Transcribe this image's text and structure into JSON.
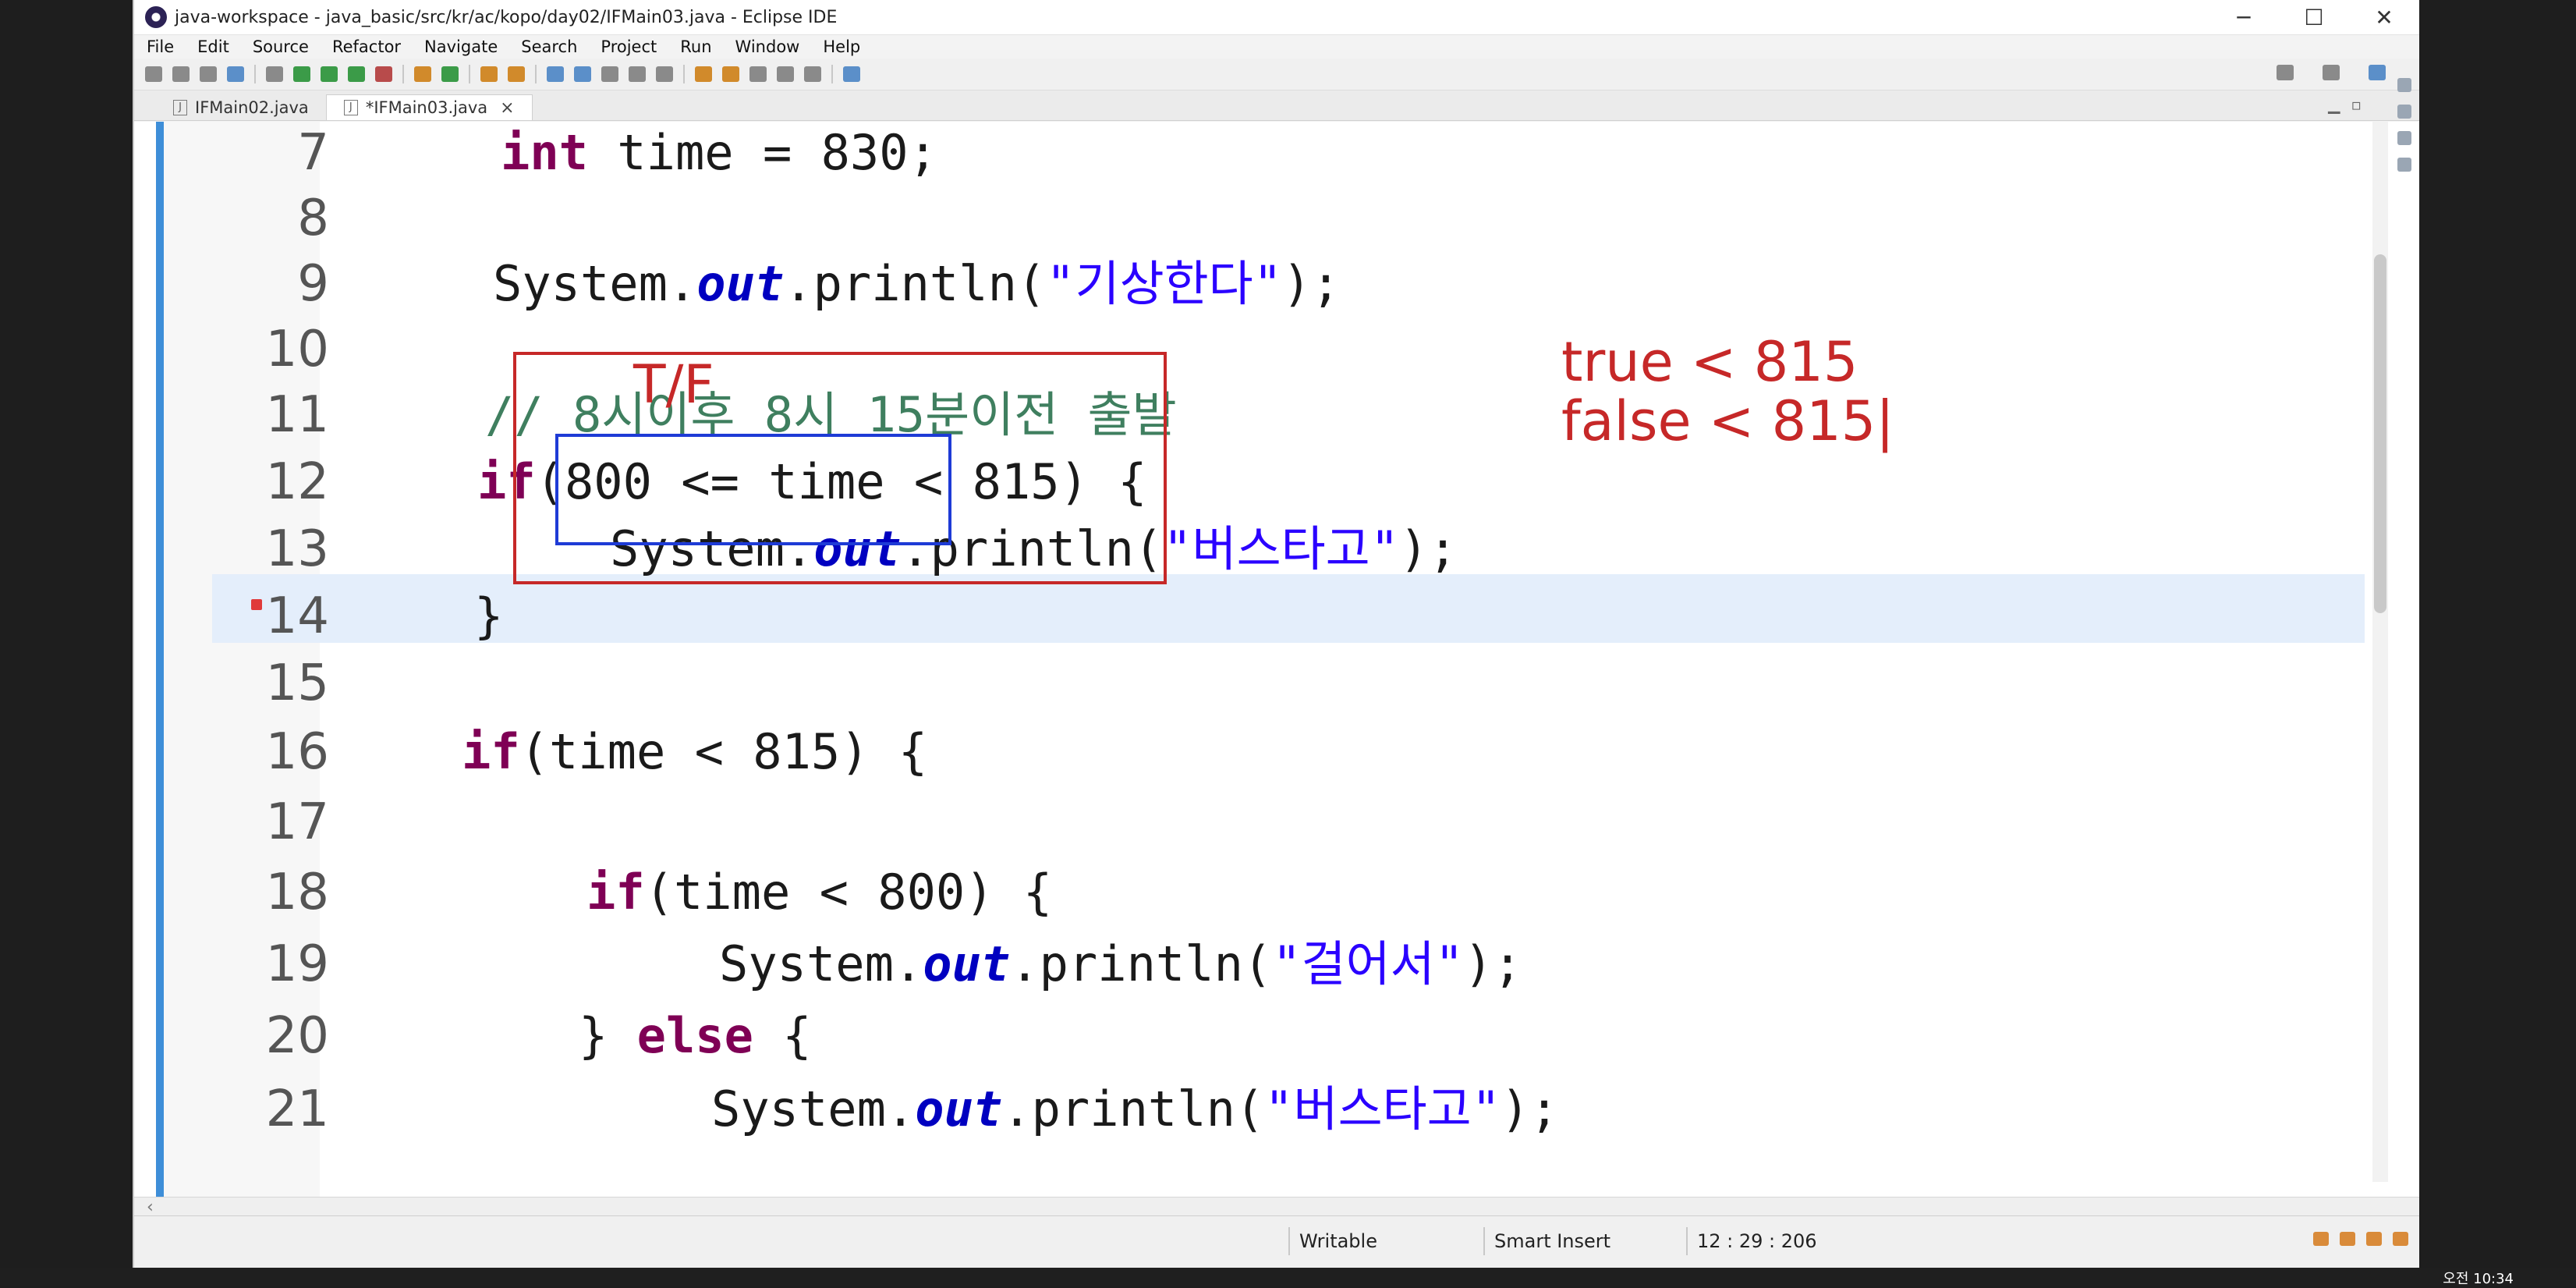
{
  "window": {
    "title": "java-workspace - java_basic/src/kr/ac/kopo/day02/IFMain03.java - Eclipse IDE",
    "minimize": "─",
    "maximize": "☐",
    "close": "✕"
  },
  "menu": [
    "File",
    "Edit",
    "Source",
    "Refactor",
    "Navigate",
    "Search",
    "Project",
    "Run",
    "Window",
    "Help"
  ],
  "tabs": [
    {
      "label": "IFMain02.java",
      "active": false
    },
    {
      "label": "*IFMain03.java",
      "active": true,
      "close": "×"
    }
  ],
  "editor": {
    "line_numbers": [
      "7",
      "8",
      "9",
      "10",
      "11",
      "12",
      "13",
      "14",
      "15",
      "16",
      "17",
      "18",
      "19",
      "20",
      "21"
    ],
    "current_line": "12",
    "code": {
      "l7_kw": "int",
      "l7_rest": " time = 830;",
      "l9_a": "System.",
      "l9_b": "out",
      "l9_c": ".println(",
      "l9_d": "\"기상한다\"",
      "l9_e": ");",
      "l11": "// 8시이후 8시 15분이전 출발",
      "l12_kw": "if",
      "l12_rest": "(800 <= time < 815) {",
      "l13_a": "System.",
      "l13_b": "out",
      "l13_c": ".println(",
      "l13_d": "\"버스타고\"",
      "l13_e": ");",
      "l14": "}",
      "l16_kw": "if",
      "l16_rest": "(time < 815) {",
      "l18_kw": "if",
      "l18_rest": "(time < 800) {",
      "l19_a": "System.",
      "l19_b": "out",
      "l19_c": ".println(",
      "l19_d": "\"걸어서\"",
      "l19_e": ");",
      "l20_a": "} ",
      "l20_kw": "else",
      "l20_b": " {",
      "l21_a": "System.",
      "l21_b": "out",
      "l21_c": ".println(",
      "l21_d": "\"버스타고\"",
      "l21_e": ");"
    }
  },
  "annotations": {
    "tf": "T/F",
    "line1": "true < 815",
    "line2": "false < 815|"
  },
  "status": {
    "mode": "Writable",
    "insert": "Smart Insert",
    "position": "12 : 29 : 206"
  },
  "taskbar": {
    "clock": "오전 10:34"
  }
}
